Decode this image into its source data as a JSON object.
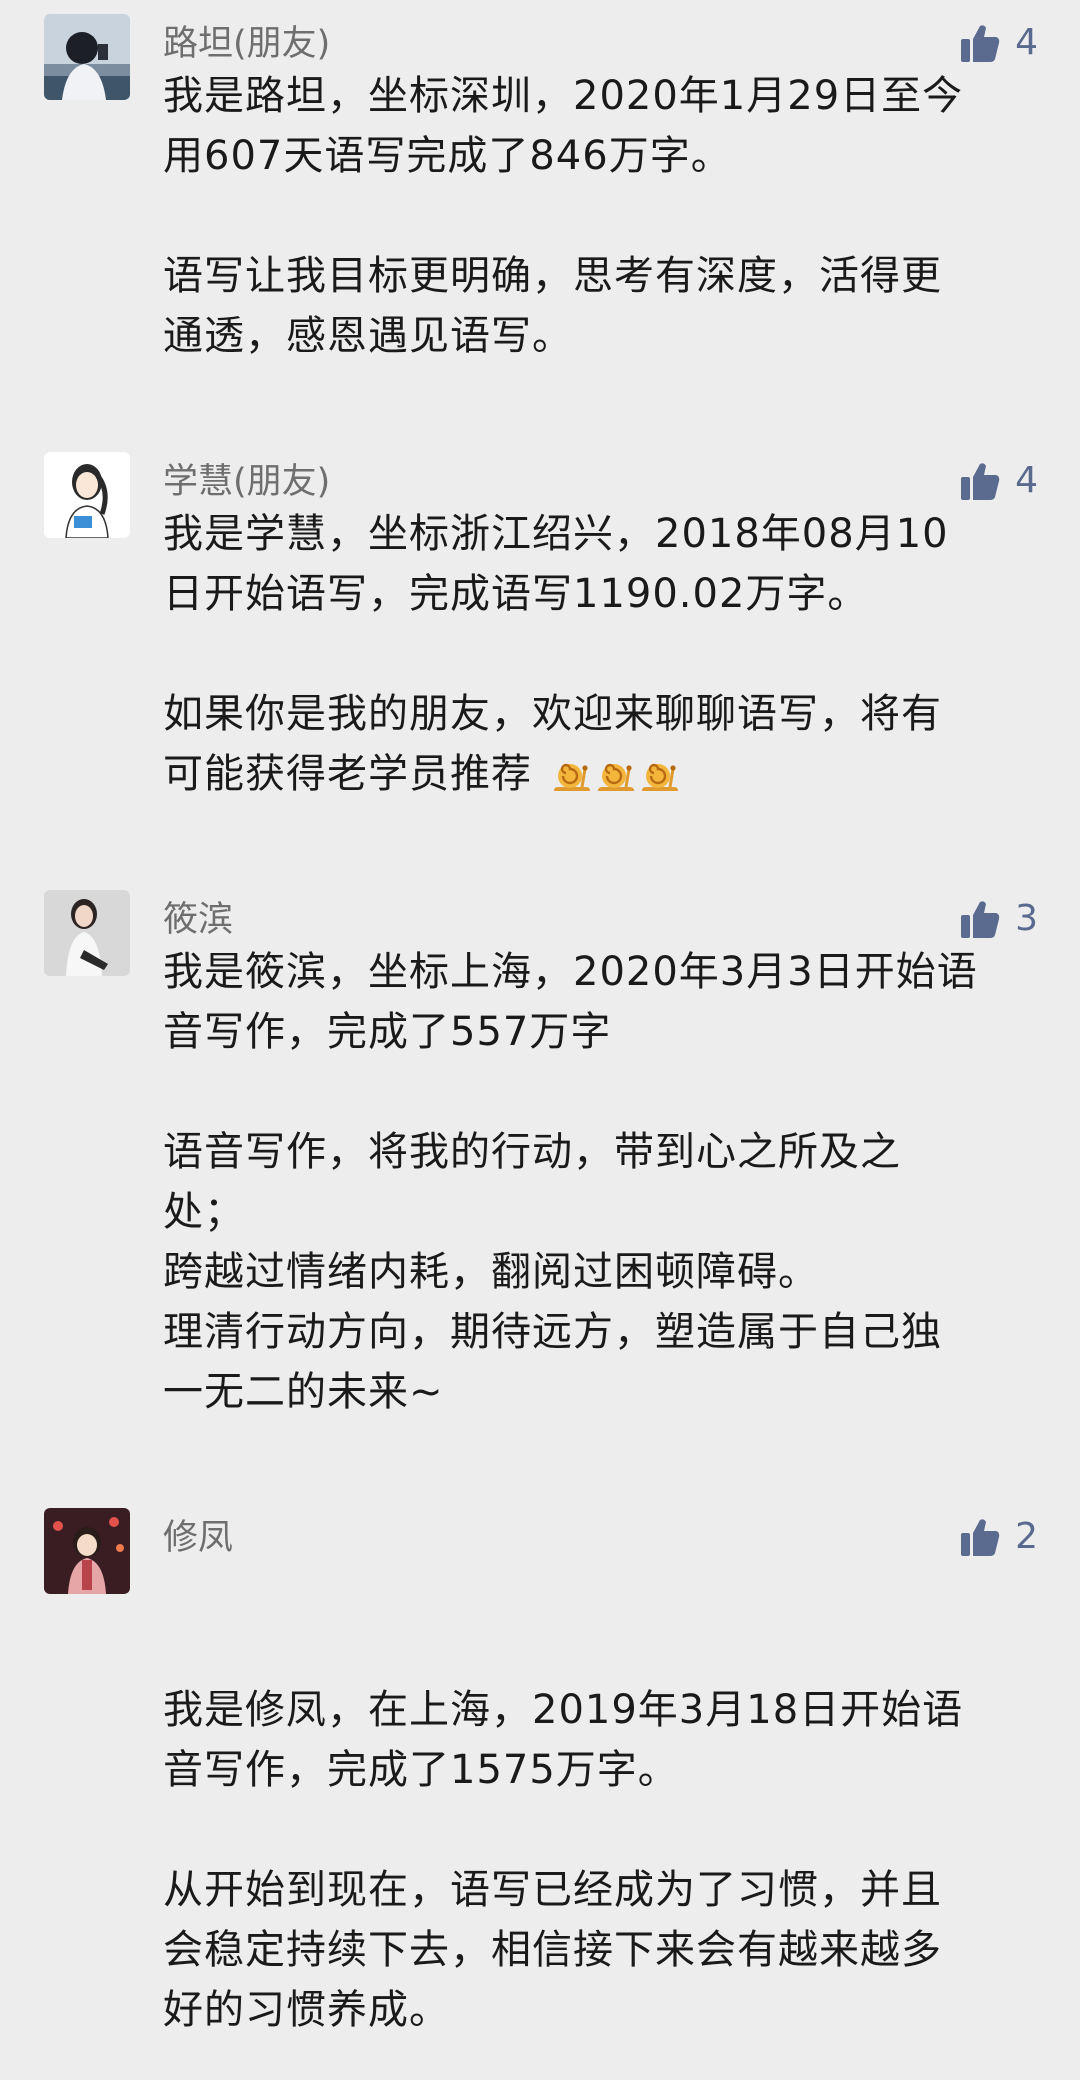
{
  "comments": [
    {
      "nickname": "路坦(朋友)",
      "likes": "4",
      "lines": [
        "我是路坦，坐标深圳，2020年1月29日至今",
        "用607天语写完成了846万字。",
        "",
        "语写让我目标更明确，思考有深度，活得更",
        "通透，感恩遇见语写。"
      ]
    },
    {
      "nickname": "学慧(朋友)",
      "likes": "4",
      "lines": [
        "我是学慧，坐标浙江绍兴，2018年08月10",
        "日开始语写，完成语写1190.02万字。",
        "",
        "如果你是我的朋友，欢迎来聊聊语写，将有",
        "可能获得老学员推荐"
      ]
    },
    {
      "nickname": "筱滨",
      "likes": "3",
      "lines": [
        "我是筱滨，坐标上海，2020年3月3日开始语",
        "音写作，完成了557万字",
        "",
        "语音写作，将我的行动，带到心之所及之",
        "处；",
        "跨越过情绪内耗，翻阅过困顿障碍。",
        "理清行动方向，期待远方，塑造属于自己独",
        "一无二的未来~"
      ]
    },
    {
      "nickname": "修凤",
      "likes": "2",
      "lines": [
        "",
        "",
        "我是修凤，在上海，2019年3月18日开始语",
        "音写作，完成了1575万字。",
        "",
        "从开始到现在，语写已经成为了习惯，并且",
        "会稳定持续下去，相信接下来会有越来越多",
        "好的习惯养成。"
      ]
    }
  ],
  "icons": {
    "like": "thumbs-up-icon",
    "emoji": "snail-emoji-icon"
  },
  "colors": {
    "background": "#ededed",
    "nickname": "#6e6e6e",
    "like": "#5a6a8e",
    "text": "#1a1a1a"
  }
}
